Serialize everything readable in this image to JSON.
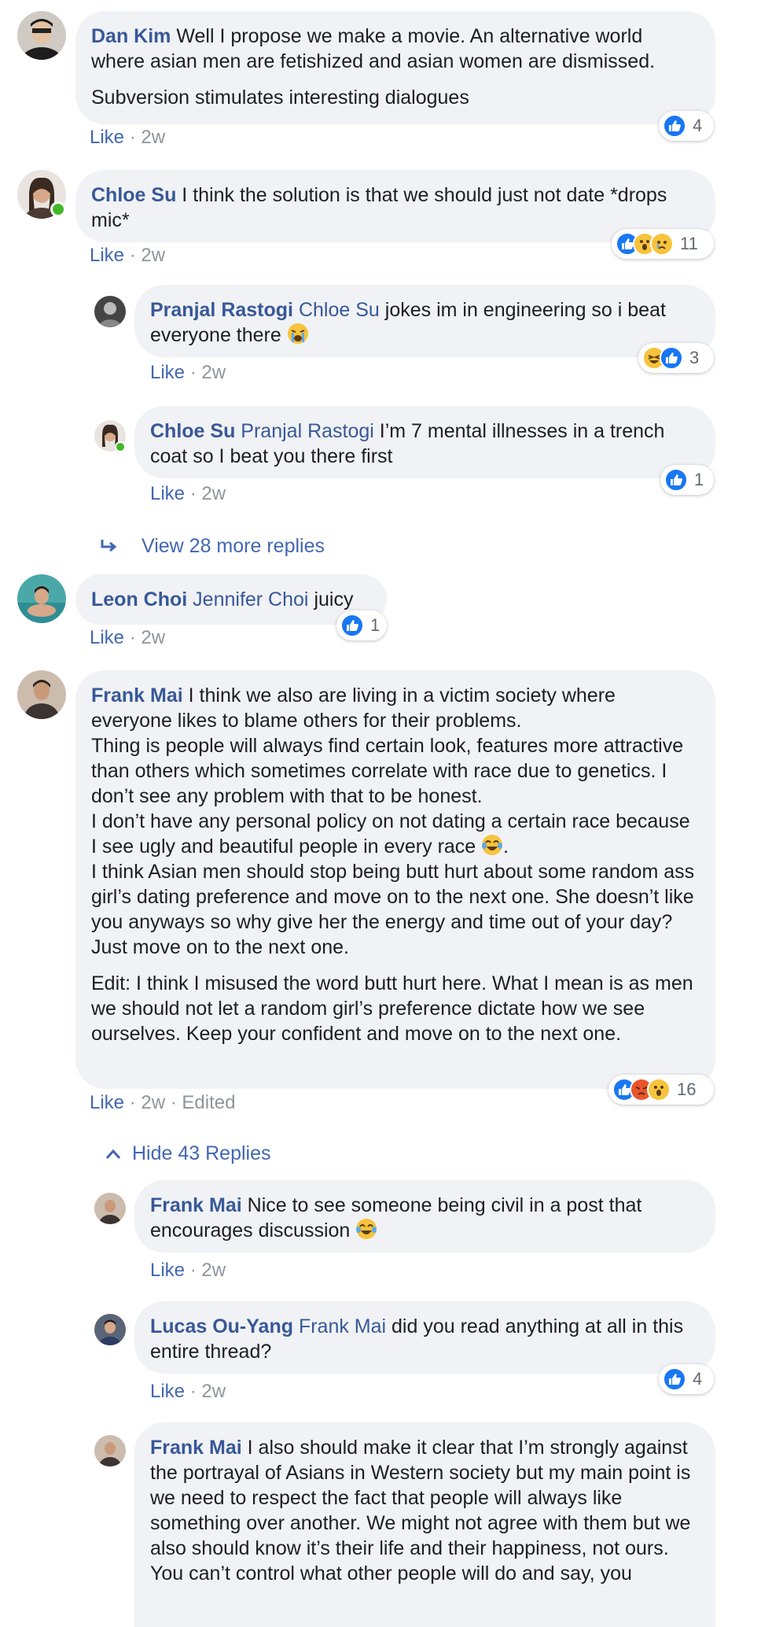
{
  "colors": {
    "link": "#385898",
    "bubble": "#f0f2f5",
    "meta": "#90949c",
    "like": "#4267b2",
    "online": "#42b72a"
  },
  "comments": [
    {
      "author": "Dan Kim",
      "text": "Well I propose we make a movie. An alternative world where asian men are fetishized and asian women are dismissed.",
      "text2": "Subversion stimulates interesting dialogues",
      "like": "Like",
      "time": "2w",
      "reaction_icons": [
        "like-icon"
      ],
      "reactions": "4"
    },
    {
      "author": "Chloe Su",
      "text": "I think the solution is that we should just not date *drops mic*",
      "like": "Like",
      "time": "2w",
      "reaction_icons": [
        "like-icon",
        "wow-icon",
        "sad-icon"
      ],
      "reactions": "11"
    },
    {
      "author": "Pranjal Rastogi",
      "mention": "Chloe Su",
      "text": "jokes im in engineering so i beat everyone there",
      "emoji": "crying-face-icon",
      "like": "Like",
      "time": "2w",
      "reaction_icons": [
        "haha-icon",
        "like-icon"
      ],
      "reactions": "3"
    },
    {
      "author": "Chloe Su",
      "mention": "Pranjal Rastogi",
      "text": "I’m 7 mental illnesses in a trench coat so I beat you there first",
      "like": "Like",
      "time": "2w",
      "reaction_icons": [
        "like-icon"
      ],
      "reactions": "1"
    },
    {
      "author": "Leon Choi",
      "mention": "Jennifer Choi",
      "text": "juicy",
      "like": "Like",
      "time": "2w",
      "reaction_icons": [
        "like-icon"
      ],
      "reactions": "1"
    },
    {
      "author": "Frank Mai",
      "text": "I think we also are living in a victim society where everyone likes to blame others for their problems.\nThing is people will always find certain look, features more attractive than others which sometimes correlate with race due to genetics. I don’t see any problem with that to be honest.\nI don’t have any personal policy on not dating a certain race because I see ugly and beautiful people in every race",
      "text_after": ".\nI think Asian men should stop being butt hurt about some random ass\ngirl’s dating preference and move on to the next one. She doesn’t like you anyways so why give her the energy and time out of your day? Just move on to the next one.",
      "text2": "Edit: I think I misused the word butt hurt here. What I mean is as men we should not let a random girl’s preference dictate how we see ourselves. Keep your confident and move on to the next one.",
      "emoji": "tears-of-joy-icon",
      "like": "Like",
      "time": "2w",
      "edited": "Edited",
      "reaction_icons": [
        "like-icon",
        "angry-icon",
        "wow-icon"
      ],
      "reactions": "16"
    },
    {
      "author": "Frank Mai",
      "text": "Nice to see someone being civil in a post that encourages discussion",
      "emoji": "tears-of-joy-icon",
      "like": "Like",
      "time": "2w"
    },
    {
      "author": "Lucas Ou-Yang",
      "mention": "Frank Mai",
      "text": "did you read anything at all in this entire thread?",
      "like": "Like",
      "time": "2w",
      "reaction_icons": [
        "like-icon"
      ],
      "reactions": "4"
    },
    {
      "author": "Frank Mai",
      "text": "I also should make it clear that I’m strongly against the portrayal of Asians in Western society but my main point is we need to respect the fact that people will always like something over another. We might not agree with them but we also should know it’s their life and their happiness, not ours.\nYou can’t control what other people will do and say, you"
    }
  ],
  "view_more": "View 28 more replies",
  "hide_replies": "Hide 43 Replies",
  "separator": "·"
}
